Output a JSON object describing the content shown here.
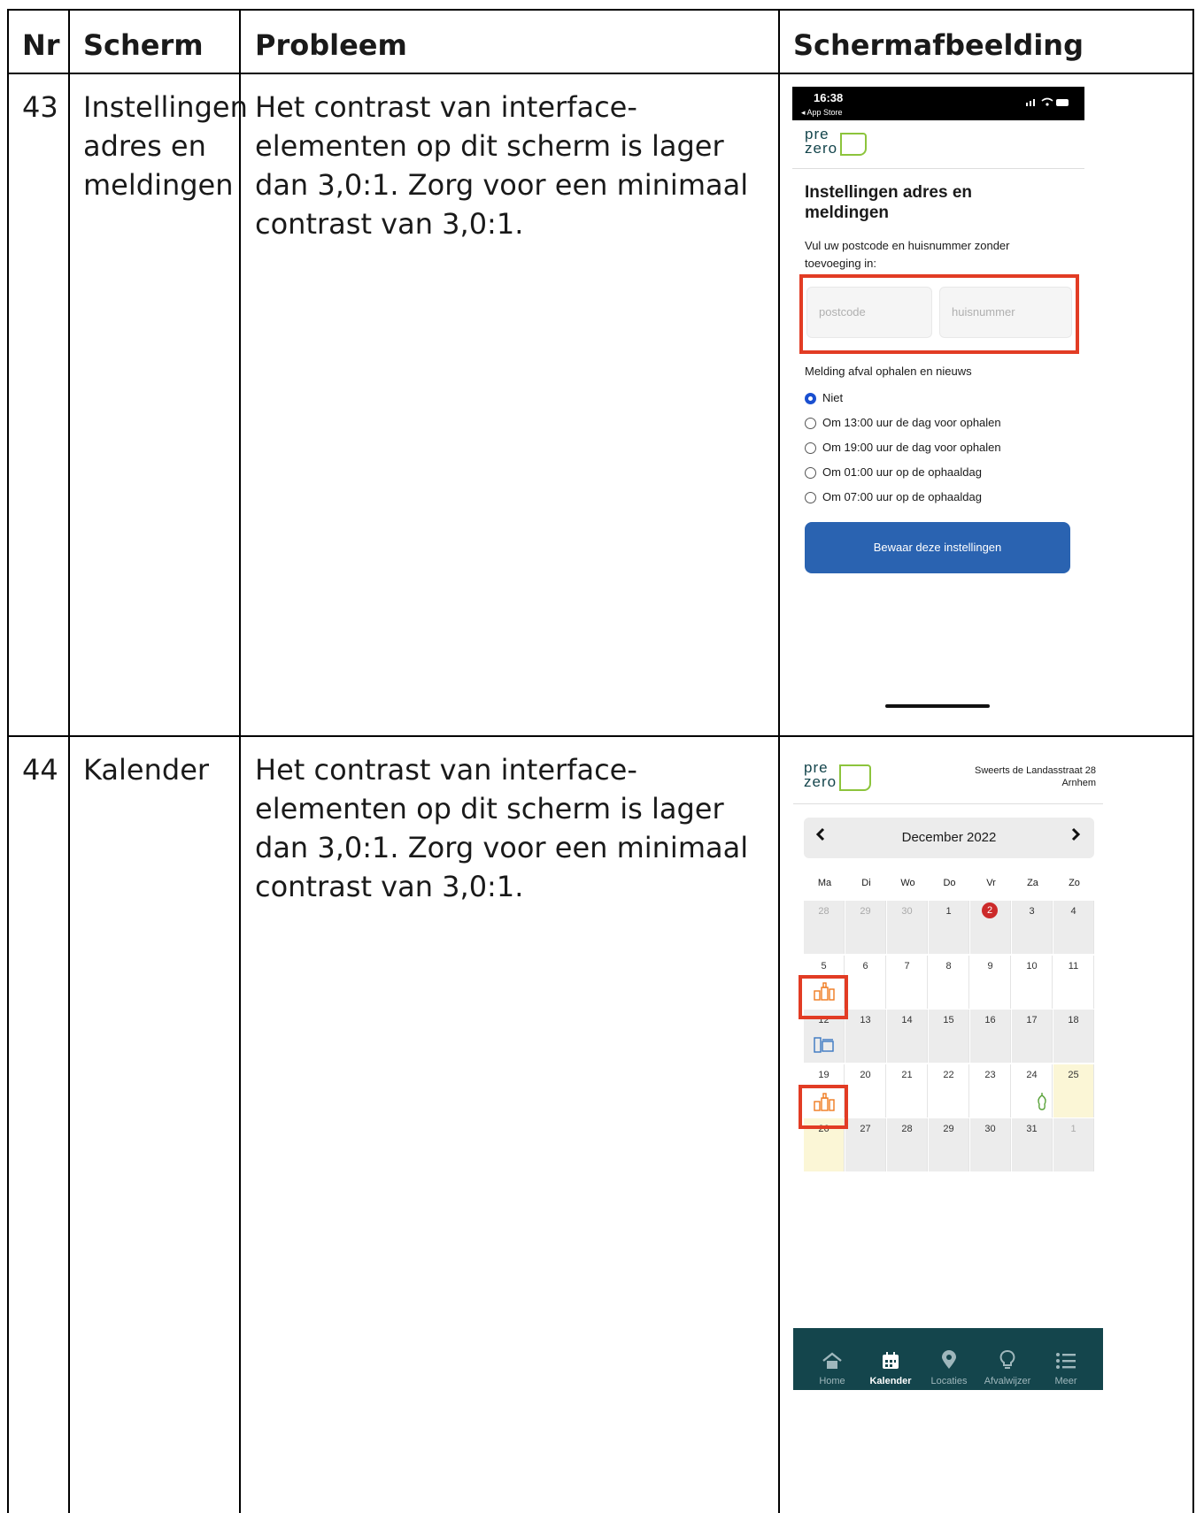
{
  "table": {
    "headers": {
      "nr": "Nr",
      "scherm": "Scherm",
      "probleem": "Probleem",
      "schermafbeelding": "Schermafbeelding"
    },
    "rows": [
      {
        "nr": "43",
        "scherm": "Instellingen adres en meldingen",
        "probleem": "Het contrast van interface-elementen op dit scherm is lager dan 3,0:1. Zorg voor een minimaal contrast van 3,0:1."
      },
      {
        "nr": "44",
        "scherm": "Kalender",
        "probleem": "Het contrast van interface-elementen op dit scherm is lager dan 3,0:1. Zorg voor een minimaal contrast van 3,0:1."
      }
    ]
  },
  "shot1": {
    "time": "16:38",
    "back": "◂ App Store",
    "logo_top": "pre",
    "logo_bottom": "zero",
    "title": "Instellingen adres en meldingen",
    "instruction": "Vul uw postcode en huisnummer zonder toevoeging in:",
    "postcode_placeholder": "postcode",
    "huisnummer_placeholder": "huisnummer",
    "melding_label": "Melding afval ophalen en nieuws",
    "options": [
      "Niet",
      "Om 13:00 uur de dag voor ophalen",
      "Om 19:00 uur de dag voor ophalen",
      "Om 01:00 uur op de ophaaldag",
      "Om 07:00 uur op de ophaaldag"
    ],
    "selected_option": 0,
    "save_button": "Bewaar deze instellingen",
    "accent": "#2a63b1",
    "highlight": "#e23c24"
  },
  "shot2": {
    "logo_top": "pre",
    "logo_bottom": "zero",
    "address_line1": "Sweerts de Landasstraat 28",
    "address_line2": "Arnhem",
    "month": "December 2022",
    "weekdays": [
      "Ma",
      "Di",
      "Wo",
      "Do",
      "Vr",
      "Za",
      "Zo"
    ],
    "weeks": [
      [
        "28",
        "29",
        "30",
        "1",
        "2",
        "3",
        "4"
      ],
      [
        "5",
        "6",
        "7",
        "8",
        "9",
        "10",
        "11"
      ],
      [
        "12",
        "13",
        "14",
        "15",
        "16",
        "17",
        "18"
      ],
      [
        "19",
        "20",
        "21",
        "22",
        "23",
        "24",
        "25"
      ],
      [
        "26",
        "27",
        "28",
        "29",
        "30",
        "31",
        "1"
      ]
    ],
    "nav": [
      "Home",
      "Kalender",
      "Locaties",
      "Afvalwijzer",
      "Meer"
    ],
    "nav_active": 1,
    "nav_bg": "#14454c"
  }
}
